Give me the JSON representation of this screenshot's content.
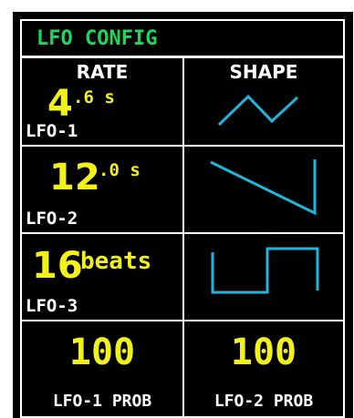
{
  "title": "LFO CONFIG",
  "headers": {
    "rate": "RATE",
    "shape": "SHAPE"
  },
  "lfos": [
    {
      "label": "LFO-1",
      "rate_main": "4",
      "rate_fraction": ".6 s",
      "shape": "triangle-wave-icon"
    },
    {
      "label": "LFO-2",
      "rate_main": "12",
      "rate_fraction": ".0 s",
      "shape": "sawtooth-wave-icon"
    },
    {
      "label": "LFO-3",
      "rate_main": "16",
      "rate_unit": "beats",
      "shape": "square-wave-icon"
    }
  ],
  "probabilities": [
    {
      "label": "LFO-1 PROB",
      "value": "100"
    },
    {
      "label": "LFO-2 PROB",
      "value": "100"
    }
  ],
  "colors": {
    "background": "#000000",
    "border": "#ffffff",
    "title": "#19d85a",
    "value": "#f2f21a",
    "label": "#ffffff",
    "waveform": "#1fb6dc"
  }
}
